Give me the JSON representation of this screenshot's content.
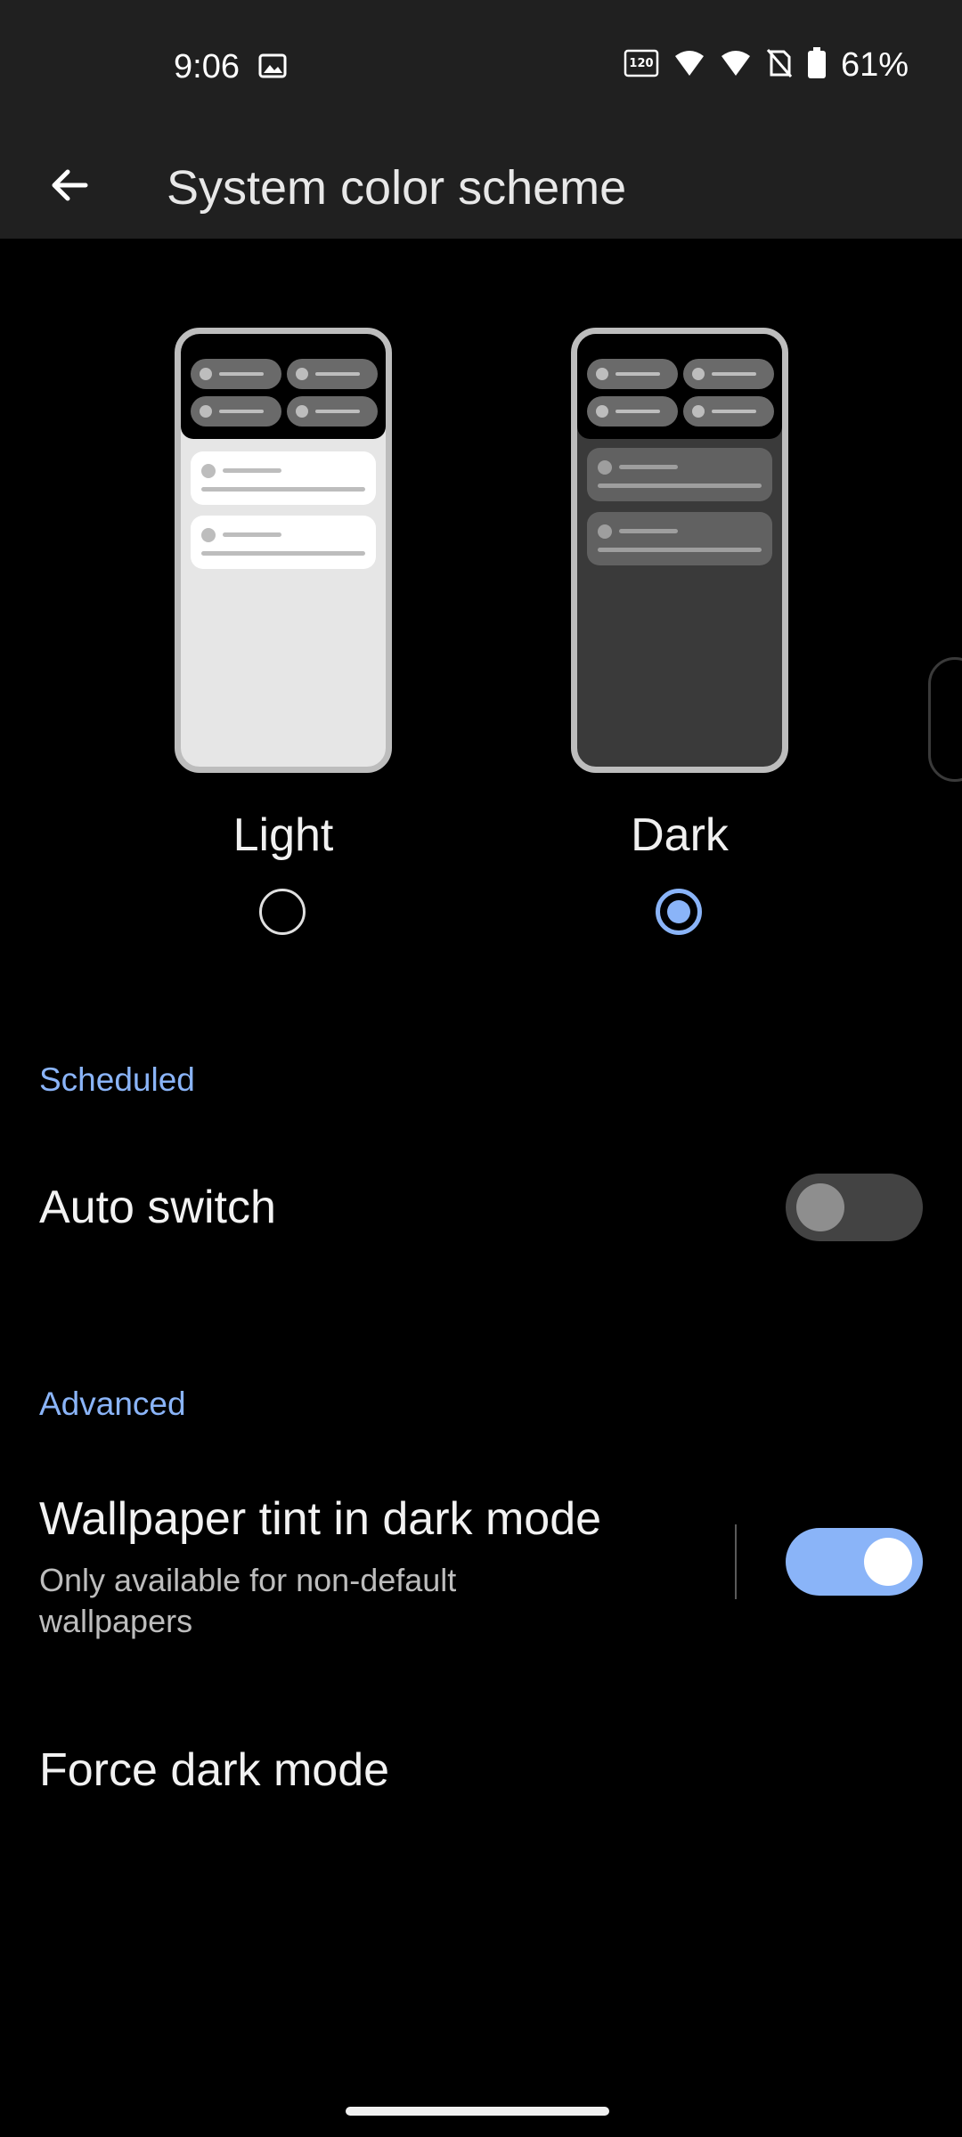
{
  "status_bar": {
    "time": "9:06",
    "battery_percent": "61%",
    "refresh_rate_label": "120",
    "icons": [
      "image-icon",
      "refresh-rate-icon",
      "wifi-icon",
      "signal-icon",
      "no-sim-icon",
      "battery-icon"
    ]
  },
  "app_bar": {
    "title": "System color scheme",
    "back_icon": "arrow-left-icon"
  },
  "scheme": {
    "options": [
      {
        "label": "Light",
        "selected": false
      },
      {
        "label": "Dark",
        "selected": true
      }
    ]
  },
  "sections": {
    "scheduled": {
      "header": "Scheduled",
      "auto_switch": {
        "title": "Auto switch",
        "enabled": false
      }
    },
    "advanced": {
      "header": "Advanced",
      "wallpaper_tint": {
        "title": "Wallpaper tint in dark mode",
        "subtitle": "Only available for non-default wallpapers",
        "enabled": true
      },
      "force_dark": {
        "title": "Force dark mode"
      }
    }
  },
  "colors": {
    "accent": "#8ab4f8",
    "bar_background": "#202020",
    "background": "#000000"
  }
}
